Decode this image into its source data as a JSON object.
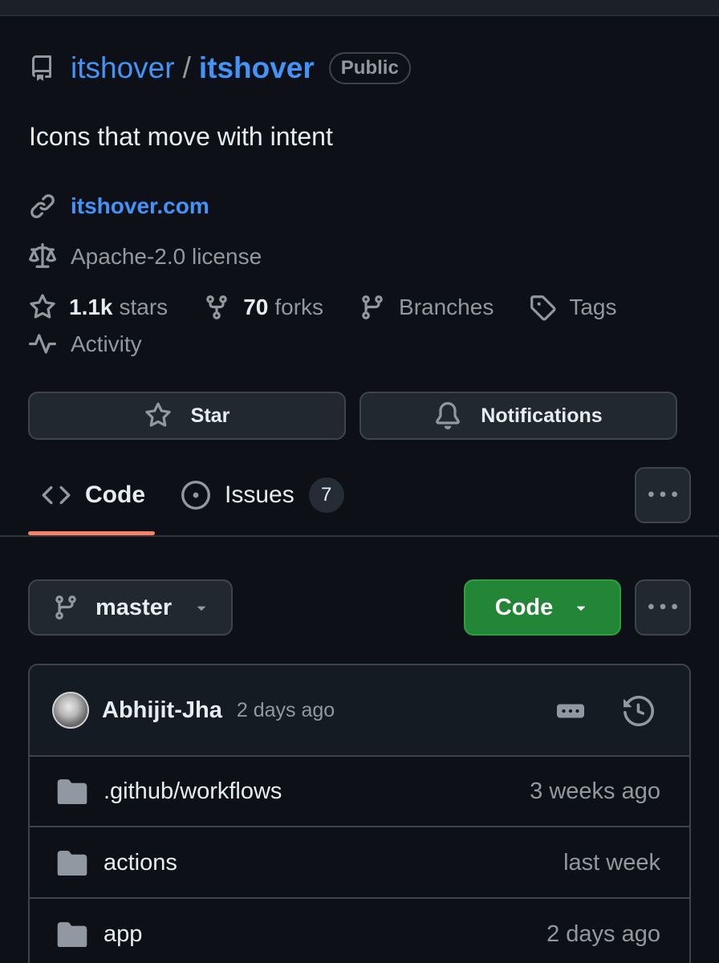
{
  "repo": {
    "owner": "itshover",
    "separator": "/",
    "name": "itshover",
    "visibility": "Public",
    "description": "Icons that move with intent",
    "website": "itshover.com",
    "license": "Apache-2.0 license",
    "stars_count": "1.1k",
    "stars_label": "stars",
    "forks_count": "70",
    "forks_label": "forks",
    "branches_label": "Branches",
    "tags_label": "Tags",
    "activity_label": "Activity"
  },
  "actions": {
    "star_label": "Star",
    "notifications_label": "Notifications"
  },
  "tabs": [
    {
      "label": "Code",
      "icon": "code-icon",
      "active": true
    },
    {
      "label": "Issues",
      "icon": "issue-opened-icon",
      "count": "7"
    }
  ],
  "toolbar": {
    "branch": "master",
    "code_button": "Code"
  },
  "latest_commit": {
    "author": "Abhijit-Jha",
    "time": "2 days ago"
  },
  "files": [
    {
      "name": ".github/workflows",
      "time": "3 weeks ago",
      "type": "folder"
    },
    {
      "name": "actions",
      "time": "last week",
      "type": "folder"
    },
    {
      "name": "app",
      "time": "2 days ago",
      "type": "folder"
    }
  ],
  "colors": {
    "background": "#0d1117",
    "link": "#4493f8",
    "accent_underline": "#f78166",
    "primary_button": "#238636"
  }
}
